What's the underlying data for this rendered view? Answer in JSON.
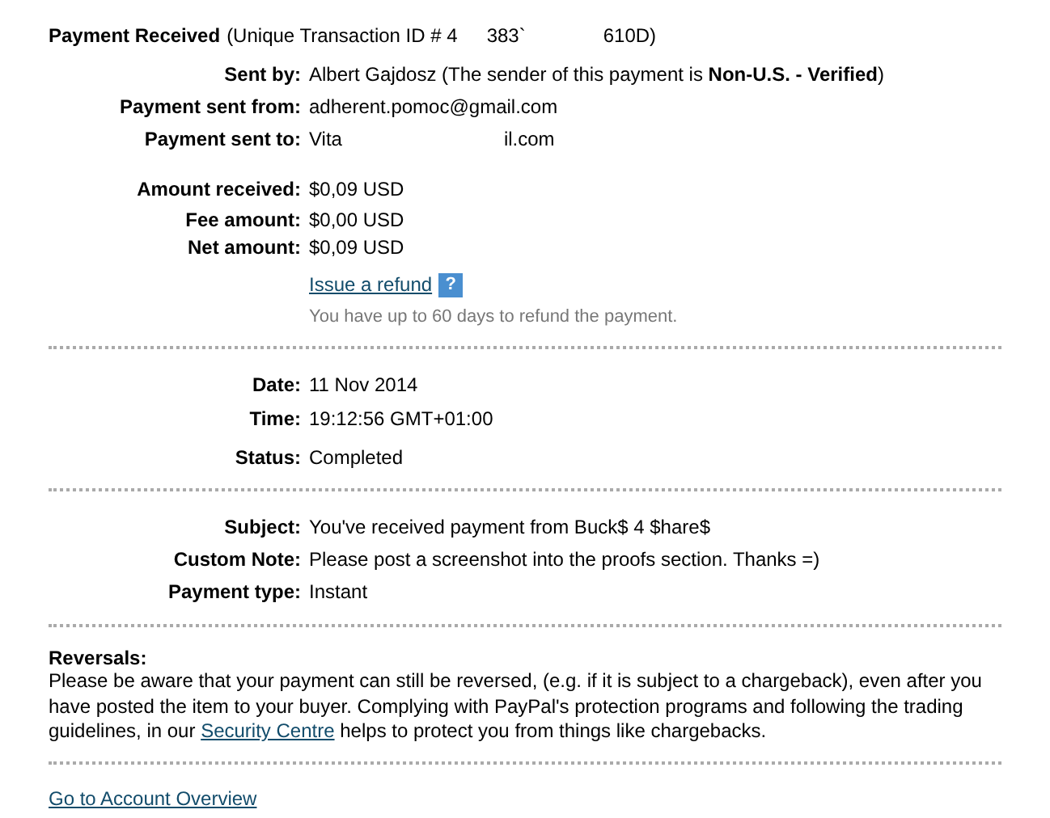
{
  "header": {
    "title": "Payment Received",
    "id_parts": [
      "(Unique Transaction ID # 4",
      "383`",
      "610D)"
    ]
  },
  "people": [
    {
      "label": "Sent by:",
      "value": "Albert Gajdosz (The sender of this payment is **Non-U.S. - Verified**)"
    },
    {
      "label": "Payment sent from:",
      "value": "adherent.pomoc@gmail.com"
    },
    {
      "label": "Payment sent to:",
      "value_parts": [
        "Vita",
        "il.com"
      ]
    }
  ],
  "amounts": [
    {
      "label": "Amount received:",
      "value": "$0,09 USD"
    },
    {
      "label": "Fee amount:",
      "value": "$0,00 USD"
    },
    {
      "label": "Net amount:",
      "value": "$0,09 USD"
    }
  ],
  "refund": {
    "link": "Issue a refund",
    "help": "?",
    "note": "You have up to 60 days to refund the payment."
  },
  "timing": [
    {
      "label": "Date:",
      "value": "11 Nov 2014"
    },
    {
      "label": "Time:",
      "value": "19:12:56 GMT+01:00"
    },
    {
      "label": "Status:",
      "value": "Completed"
    }
  ],
  "details": [
    {
      "label": "Subject:",
      "value": "You've received payment from Buck$ 4 $hare$"
    },
    {
      "label": "Custom Note:",
      "value": "Please post a screenshot into the proofs section. Thanks =)"
    },
    {
      "label": "Payment type:",
      "value": "Instant"
    }
  ],
  "reversals": {
    "heading": "Reversals:",
    "text_before": "Please be aware that your payment can still be reversed, (e.g. if it is subject to a chargeback), even after you have posted the item to your buyer. Complying with PayPal's protection programs and following the trading guidelines, in our",
    "link": "Security Centre",
    "text_after": "helps to protect you from things like chargebacks."
  },
  "footer_link": "Go to Account Overview"
}
